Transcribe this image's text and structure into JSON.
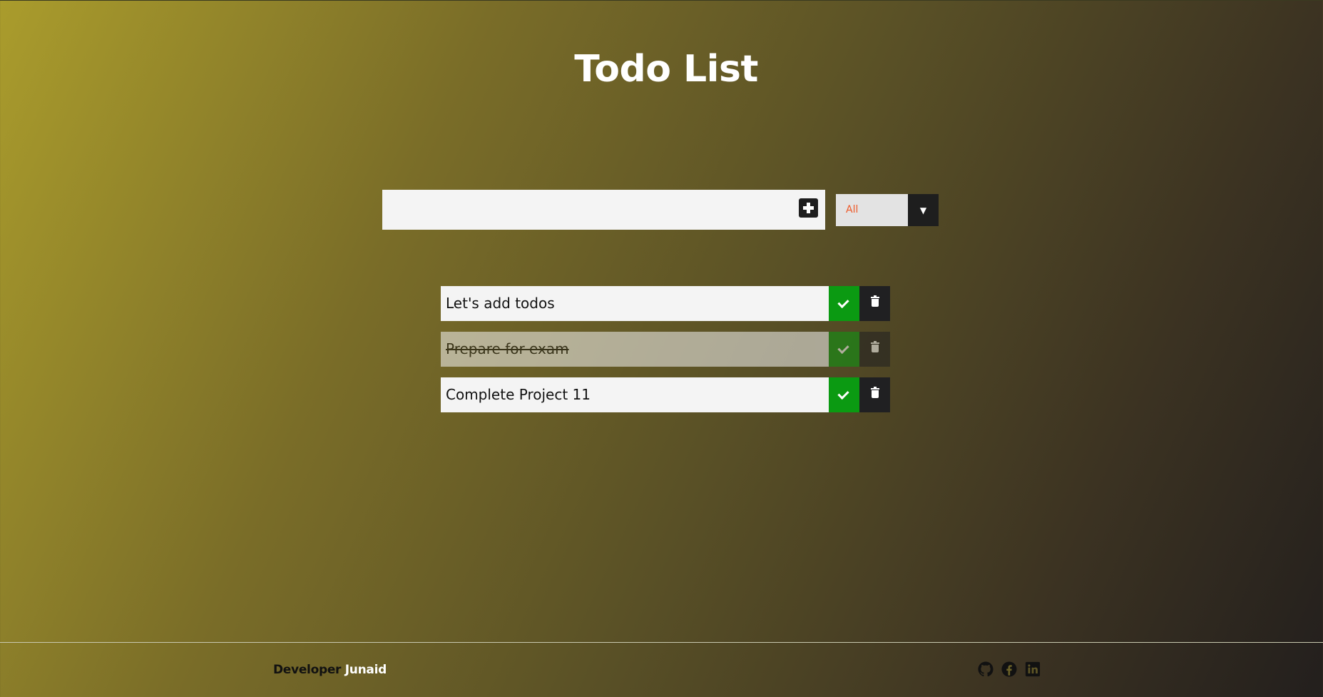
{
  "header": {
    "title": "Todo List"
  },
  "new_todo": {
    "value": "",
    "placeholder": "",
    "add_icon": "plus-square-icon"
  },
  "filter": {
    "selected": "All",
    "arrow_icon": "caret-down-icon",
    "arrow_glyph": "▼"
  },
  "todos": [
    {
      "text": "Let's add todos",
      "completed": false
    },
    {
      "text": "Prepare for exam",
      "completed": true
    },
    {
      "text": "Complete Project 11",
      "completed": false
    }
  ],
  "footer": {
    "developer_label": "Developer",
    "developer_name": "Junaid",
    "socials": [
      "github-icon",
      "facebook-icon",
      "linkedin-icon"
    ]
  },
  "colors": {
    "check_button": "#0b9a12",
    "trash_button": "#202022",
    "filter_text": "#ee5a2a",
    "item_background": "#f4f4f4"
  }
}
